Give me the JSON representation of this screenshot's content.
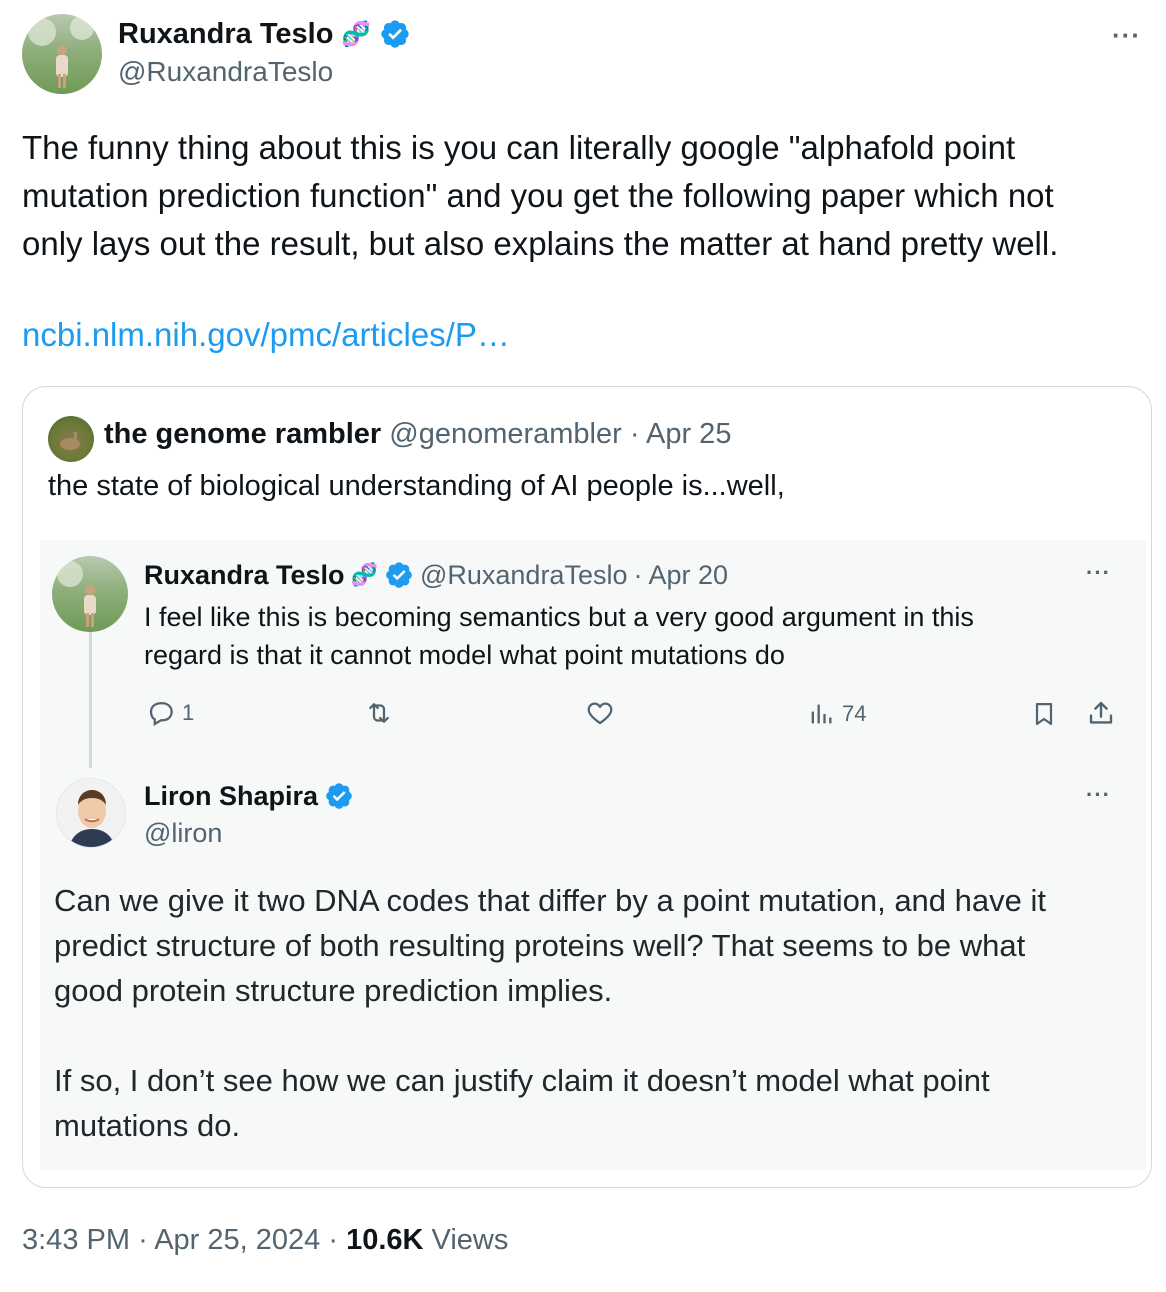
{
  "tweet": {
    "author": {
      "name": "Ruxandra Teslo",
      "emoji": "🧬",
      "handle": "@RuxandraTeslo"
    },
    "more_label": "···",
    "text_lines": [
      "The funny thing about this is you can literally google \"alphafold point",
      "mutation prediction function\" and you get the following paper which not",
      "only lays out the result, but also explains the matter at hand pretty well."
    ],
    "link": "ncbi.nlm.nih.gov/pmc/articles/P…",
    "footer": {
      "time": "3:43 PM",
      "sep1": "·",
      "date": "Apr 25, 2024",
      "sep2": "·",
      "views_count": "10.6K",
      "views_label": "Views"
    }
  },
  "quote": {
    "author": {
      "name": "the genome rambler",
      "handle": "@genomerambler",
      "sep": "·",
      "date": "Apr 25"
    },
    "text": "the state of biological understanding of AI people is...well,",
    "thread": [
      {
        "author": {
          "name": "Ruxandra Teslo",
          "emoji": "🧬",
          "handle": "@RuxandraTeslo",
          "sep": "·",
          "date": "Apr 20"
        },
        "more_label": "···",
        "text_lines": [
          "I feel like this is becoming semantics but a very good argument in this",
          "regard is that it cannot model what point mutations do"
        ],
        "actions": {
          "reply_count": "1",
          "retweet_count": "",
          "like_count": "",
          "views_count": "74"
        }
      },
      {
        "author": {
          "name": "Liron Shapira",
          "handle": "@liron"
        },
        "more_label": "···",
        "text_lines": [
          "Can we give it two DNA codes that differ by a point mutation, and have it",
          "predict structure of both resulting proteins well? That seems to be what",
          "good protein structure prediction implies.",
          "",
          "If so, I don’t see how we can justify claim it doesn’t model what point",
          "mutations do."
        ]
      }
    ]
  },
  "colors": {
    "link": "#1d9bf0",
    "verified": "#1d9bf0",
    "muted": "#536471",
    "text": "#0f1419",
    "border": "#cfd9de"
  },
  "icons": [
    "verified-badge-icon",
    "dna-icon",
    "more-icon",
    "reply-icon",
    "retweet-icon",
    "like-icon",
    "views-icon",
    "bookmark-icon",
    "share-icon"
  ]
}
